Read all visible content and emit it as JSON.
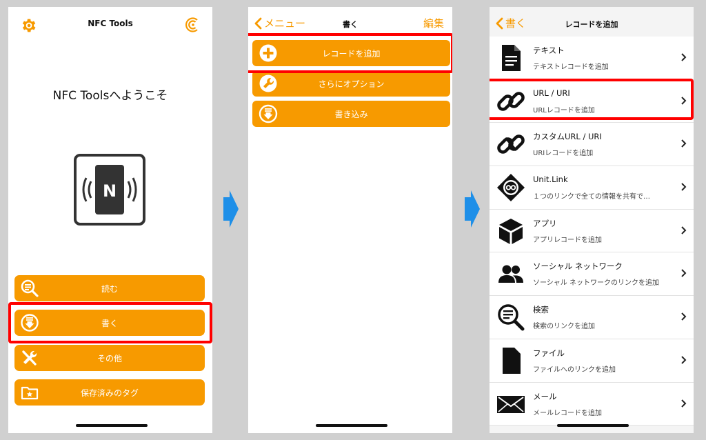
{
  "colors": {
    "accent": "#f79a00",
    "highlight": "#ff0000",
    "step_arrow": "#1e8fe8"
  },
  "screen1": {
    "title": "NFC Tools",
    "welcome": "NFC Toolsへようこそ",
    "buttons": [
      {
        "label": "読む",
        "icon": "read-magnifier-icon"
      },
      {
        "label": "書く",
        "icon": "write-download-icon"
      },
      {
        "label": "その他",
        "icon": "tools-icon"
      },
      {
        "label": "保存済みのタグ",
        "icon": "saved-folder-icon"
      }
    ]
  },
  "screen2": {
    "back": "メニュー",
    "title": "書く",
    "edit": "編集",
    "buttons": [
      {
        "label": "レコードを追加",
        "icon": "plus-circle-icon"
      },
      {
        "label": "さらにオプション",
        "icon": "wrench-icon"
      },
      {
        "label": "書き込み",
        "icon": "write-download-icon"
      }
    ]
  },
  "screen3": {
    "back": "書く",
    "title": "レコードを追加",
    "items": [
      {
        "title": "テキスト",
        "subtitle": "テキストレコードを追加",
        "icon": "document-icon"
      },
      {
        "title": "URL / URI",
        "subtitle": "URLレコードを追加",
        "icon": "link-icon"
      },
      {
        "title": "カスタムURL / URI",
        "subtitle": "URIレコードを追加",
        "icon": "custom-link-icon"
      },
      {
        "title": "Unit.Link",
        "subtitle": "１つのリンクで全ての情報を共有で…",
        "icon": "unit-link-icon"
      },
      {
        "title": "アプリ",
        "subtitle": "アプリレコードを追加",
        "icon": "app-box-icon"
      },
      {
        "title": "ソーシャル ネットワーク",
        "subtitle": "ソーシャル ネットワークのリンクを追加",
        "icon": "people-icon"
      },
      {
        "title": "検索",
        "subtitle": "検索のリンクを追加",
        "icon": "search-icon"
      },
      {
        "title": "ファイル",
        "subtitle": "ファイルへのリンクを追加",
        "icon": "file-icon"
      },
      {
        "title": "メール",
        "subtitle": "メールレコードを追加",
        "icon": "mail-icon"
      }
    ]
  }
}
